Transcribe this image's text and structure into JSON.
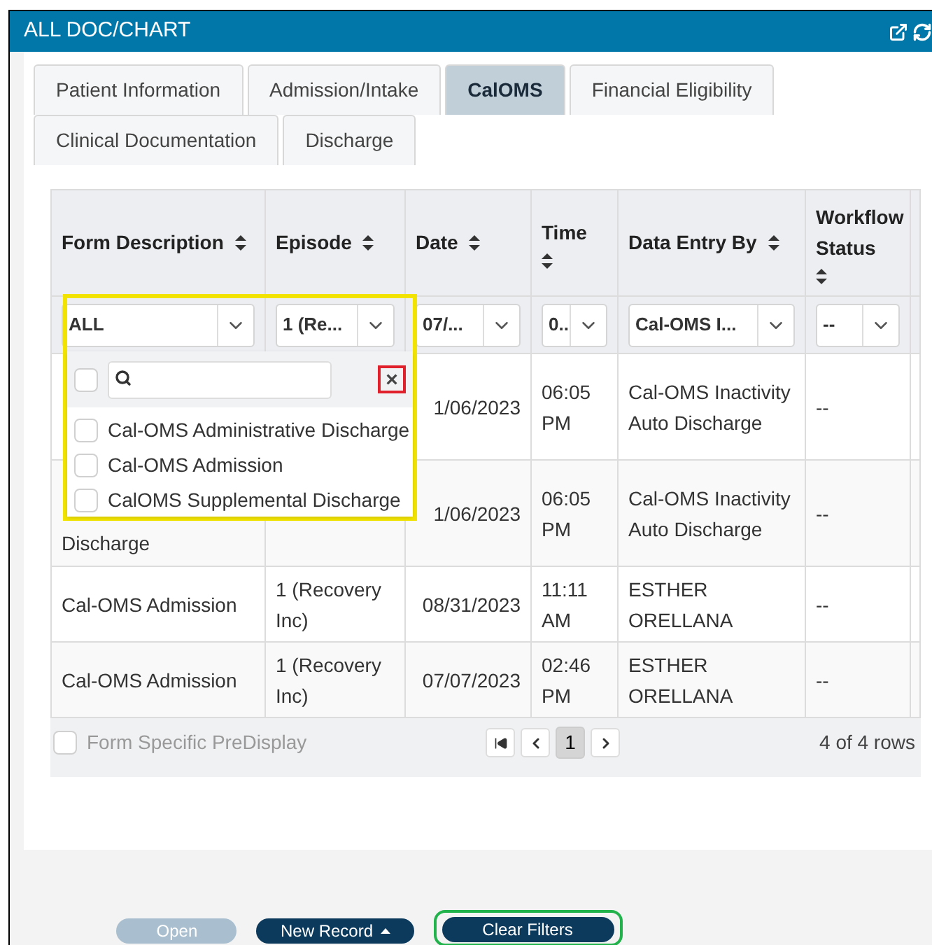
{
  "window": {
    "title": "ALL DOC/CHART"
  },
  "tabs": [
    [
      {
        "label": "Patient Information",
        "selected": false
      },
      {
        "label": "Admission/Intake",
        "selected": false
      },
      {
        "label": "CalOMS",
        "selected": true
      },
      {
        "label": "Financial Eligibility",
        "selected": false
      }
    ],
    [
      {
        "label": "Clinical Documentation",
        "selected": false
      },
      {
        "label": "Discharge",
        "selected": false
      }
    ]
  ],
  "table": {
    "columns": [
      {
        "label": "Form Description",
        "filter": "ALL"
      },
      {
        "label": "Episode",
        "filter": "1 (Re..."
      },
      {
        "label": "Date",
        "filter": "07/..."
      },
      {
        "label": "Time",
        "filter": "0..."
      },
      {
        "label": "Data Entry By",
        "filter": "Cal-OMS I..."
      },
      {
        "label": "Workflow Status",
        "filter": "--"
      }
    ],
    "rows": [
      {
        "cells": [
          null,
          null,
          "1/06/2023",
          "06:05 PM",
          "Cal-OMS Inactivity Auto Discharge",
          "--"
        ]
      },
      {
        "cells": [
          "Discharge",
          null,
          "1/06/2023",
          "06:05 PM",
          "Cal-OMS Inactivity Auto Discharge",
          "--"
        ]
      },
      {
        "cells": [
          "Cal-OMS Admission",
          "1 (Recovery Inc)",
          "08/31/2023",
          "11:11 AM",
          "ESTHER ORELLANA",
          "--"
        ]
      },
      {
        "cells": [
          "Cal-OMS Admission",
          "1 (Recovery Inc)",
          "07/07/2023",
          "02:46 PM",
          "ESTHER ORELLANA",
          "--"
        ]
      }
    ],
    "footer": {
      "predisplay": {
        "label": "Form Specific PreDisplay",
        "checked": false
      },
      "pages": [
        {
          "label": "1",
          "selected": true
        }
      ],
      "count": "4 of 4 rows"
    }
  },
  "filter_dropdown": {
    "select_all": false,
    "close": "×",
    "options": [
      {
        "label": "Cal-OMS Administrative Discharge",
        "checked": false
      },
      {
        "label": "Cal-OMS Admission",
        "checked": false
      },
      {
        "label": "CalOMS Supplemental Discharge",
        "checked": false
      }
    ]
  },
  "buttons": [
    {
      "label": "Open",
      "disabled": true,
      "caret": false
    },
    {
      "label": "New Record",
      "disabled": false,
      "caret": true
    },
    {
      "label": "Clear Filters",
      "disabled": false,
      "caret": false
    }
  ]
}
